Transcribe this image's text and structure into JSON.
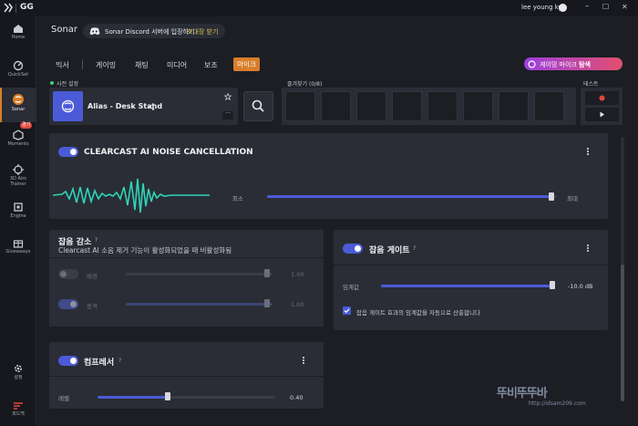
{
  "titlebar": {
    "app_name": "GG",
    "user_name": "lee young kyu",
    "min": "–",
    "max": "☐",
    "close": "✕"
  },
  "sidebar": {
    "items": [
      {
        "label": "Home"
      },
      {
        "label": "QuickSet"
      },
      {
        "label": "Sonar"
      },
      {
        "label": "Moments",
        "badge": "경기"
      },
      {
        "label": "3D Aim Trainer"
      },
      {
        "label": "Engine"
      },
      {
        "label": "Giveaways"
      },
      {
        "label": "설정"
      },
      {
        "label": "피드백"
      }
    ]
  },
  "header": {
    "title": "Sonar",
    "discord_text": "Sonar Discord 서버에 입장하기",
    "discord_link": "초대장 받기"
  },
  "tabs": [
    "믹서",
    "게이밍",
    "채팅",
    "미디어",
    "보조",
    "마이크"
  ],
  "gaming_mic": {
    "label": "게이밍 마이크",
    "action": "탐색"
  },
  "preset": {
    "section_label": "사전 설정",
    "name": "Alias - Desk Stand"
  },
  "favorites": {
    "label": "즐겨찾기 (0/8)"
  },
  "test": {
    "label": "테스트"
  },
  "clearcast": {
    "title": "CLEARCAST AI NOISE CANCELLATION",
    "help": "?",
    "min_label": "최소",
    "max_label": "최대",
    "level": 0.99
  },
  "noise_reduction": {
    "title": "잡음 감소",
    "help": "?",
    "subtitle": "Clearcast AI 소음 제거 기능이 활성화되었을 때 비활성화됨",
    "rows": [
      {
        "label": "배경",
        "value": "1.00",
        "enabled": false
      },
      {
        "label": "충격",
        "value": "1.00",
        "enabled": true
      }
    ]
  },
  "noise_gate": {
    "title": "잡음 게이트",
    "help": "?",
    "threshold_label": "임계값",
    "threshold_value": "-10.0 dB",
    "auto_label": "잡음 게이트 효과의 임계값을 자동으로 산출합니다"
  },
  "compressor": {
    "title": "컴프레서",
    "help": "?",
    "level_label": "레벨",
    "level_value": "0.40"
  },
  "watermark": {
    "text": "뚜비뚜뚜바",
    "url": "http://idsam209.com"
  },
  "colors": {
    "accent": "#4b5bd8",
    "mic_tab": "#d97e2a",
    "wave": "#2fd4b8"
  }
}
